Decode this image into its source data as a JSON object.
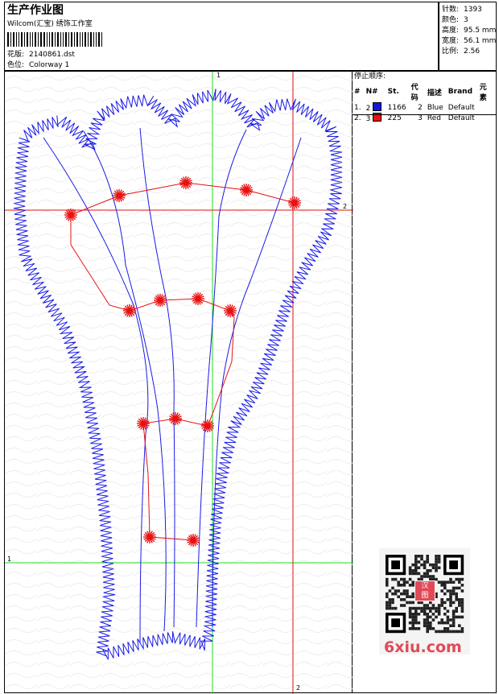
{
  "header": {
    "title": "生产作业图",
    "company": "Wilcom(汇宝) 绣饰工作室",
    "design_label": "花版:",
    "design_value": "2140861.dst",
    "colorway_label": "色位:",
    "colorway_value": "Colorway 1"
  },
  "stats": [
    {
      "label": "针数:",
      "value": "1393"
    },
    {
      "label": "颜色:",
      "value": "3"
    },
    {
      "label": "高度:",
      "value": "95.5 mm"
    },
    {
      "label": "宽度:",
      "value": "56.1 mm"
    },
    {
      "label": "比例:",
      "value": "2.56"
    }
  ],
  "stop_sequence": {
    "title": "停止顺序:",
    "headers": [
      "#",
      "N#",
      "St.",
      "代码",
      "描述",
      "Brand",
      "元素"
    ],
    "rows": [
      {
        "index": "1.",
        "n": "2",
        "swatch": "#1515e0",
        "stitches": "1166",
        "code": "2",
        "desc": "Blue",
        "brand": "Default"
      },
      {
        "index": "2.",
        "n": "3",
        "swatch": "#ee1111",
        "stitches": "225",
        "code": "3",
        "desc": "Red",
        "brand": "Default"
      }
    ]
  },
  "guides": {
    "v_top": "1",
    "h_right": "2",
    "h_left": "1",
    "v_bottom": "2"
  },
  "colors": {
    "blue_thread": "#1a1ae6",
    "red_thread": "#e81010",
    "guide_green": "#22dd22",
    "guide_red": "#dd1111"
  },
  "watermark": {
    "qr_tag_top": "汉",
    "qr_tag_bottom": "图",
    "brand": "6xiu.com"
  }
}
